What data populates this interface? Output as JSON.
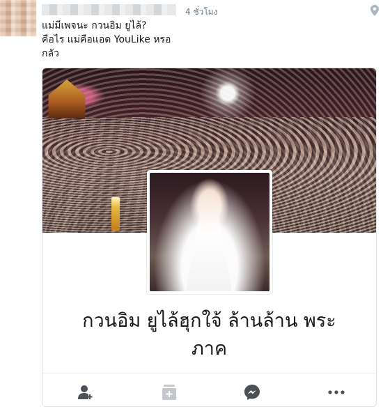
{
  "tweet": {
    "timestamp": "4 ชั่วโมง",
    "text": "แม่มีเพจนะ กวนอิม ยูไล้?\nคือไร แม่คือแอด YouLike หรอ\nกลัว"
  },
  "card": {
    "page_title": "กวนอิม ยูไล้ฮุกใจ้ ล้านล้าน พระภาค"
  },
  "icons": {
    "location": "location-pin-icon",
    "add_friend": "add-friend-icon",
    "save": "save-icon",
    "messenger": "messenger-icon",
    "more": "more-dots-icon"
  },
  "colors": {
    "text": "#14171a",
    "muted": "#657786",
    "icon": "#4b4f56",
    "border": "#dfe3e6"
  }
}
